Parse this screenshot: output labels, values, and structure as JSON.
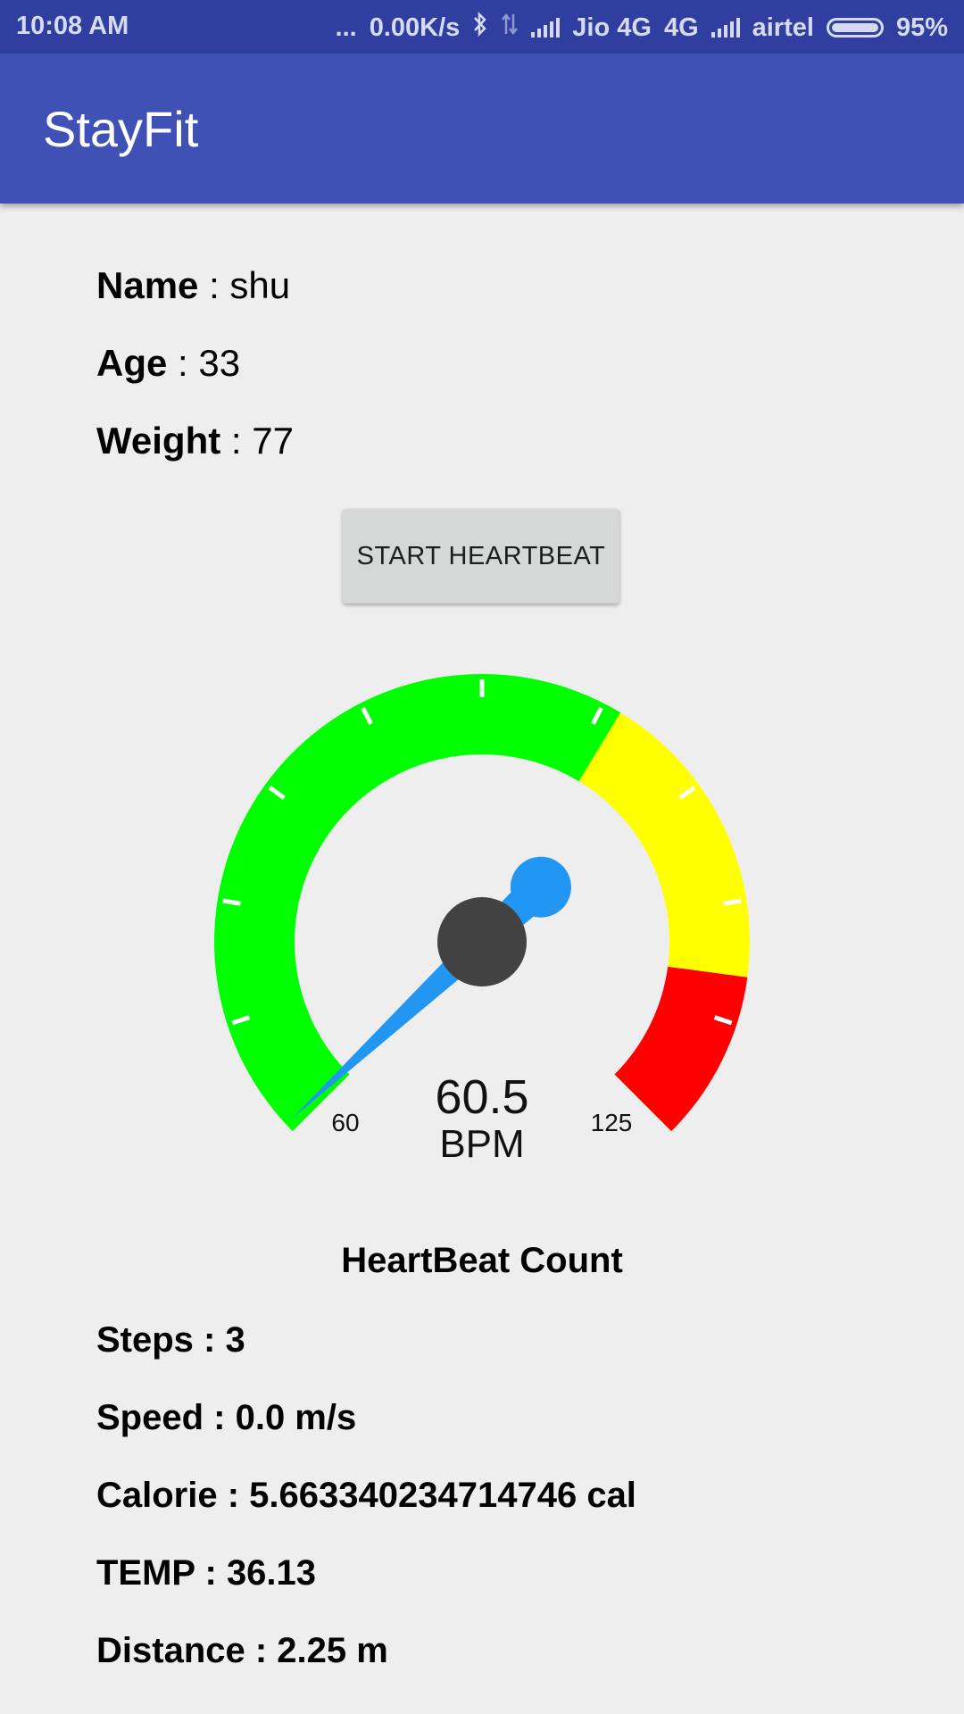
{
  "status_bar": {
    "time": "10:08 AM",
    "dots": "...",
    "speed": "0.00K/s",
    "carrier1": "Jio 4G",
    "network": "4G",
    "carrier2": "airtel",
    "battery": "95%"
  },
  "app": {
    "title": "StayFit"
  },
  "profile": {
    "name_label": "Name",
    "name_value": " : shu",
    "age_label": "Age",
    "age_value": " : 33",
    "weight_label": "Weight",
    "weight_value": " : 77"
  },
  "button": {
    "label": "START HEARTBEAT"
  },
  "gauge": {
    "value": 60.5,
    "value_text": "60.5",
    "unit": "BPM",
    "min": 60,
    "max": 125,
    "min_label": "60",
    "max_label": "125",
    "zones": [
      {
        "from": 60,
        "to": 100,
        "color": "#00ff00"
      },
      {
        "from": 100,
        "to": 116,
        "color": "#ffff00"
      },
      {
        "from": 116,
        "to": 125,
        "color": "#ff0000"
      }
    ],
    "needle_color": "#2196f3",
    "hub_color": "#424242"
  },
  "stats": {
    "title": "HeartBeat Count",
    "steps": "Steps : 3",
    "speed": "Speed : 0.0 m/s",
    "calorie": "Calorie : 5.663340234714746 cal",
    "temp": "TEMP : 36.13",
    "distance": "Distance : 2.25 m"
  }
}
